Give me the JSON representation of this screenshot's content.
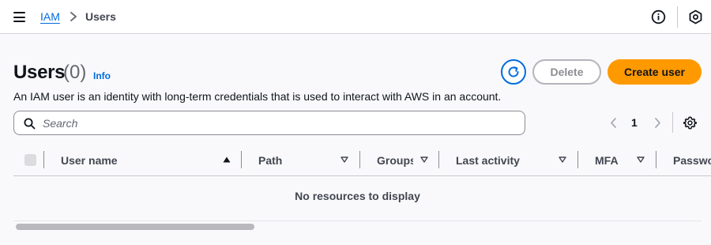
{
  "breadcrumb": {
    "root": "IAM",
    "current": "Users"
  },
  "page": {
    "title": "Users",
    "count": "(0)",
    "info_link": "Info",
    "description": "An IAM user is an identity with long-term credentials that is used to interact with AWS in an account."
  },
  "actions": {
    "delete_label": "Delete",
    "create_label": "Create user"
  },
  "search": {
    "placeholder": "Search",
    "value": ""
  },
  "pagination": {
    "current_page": "1"
  },
  "table": {
    "columns": [
      "User name",
      "Path",
      "Groups",
      "Last activity",
      "MFA",
      "Password age"
    ],
    "sorted_column": "User name",
    "sort_direction": "ascending",
    "empty_message": "No resources to display"
  },
  "colors": {
    "link": "#006ce0",
    "primary_button": "#ff9900",
    "background": "#f9f9fb"
  }
}
